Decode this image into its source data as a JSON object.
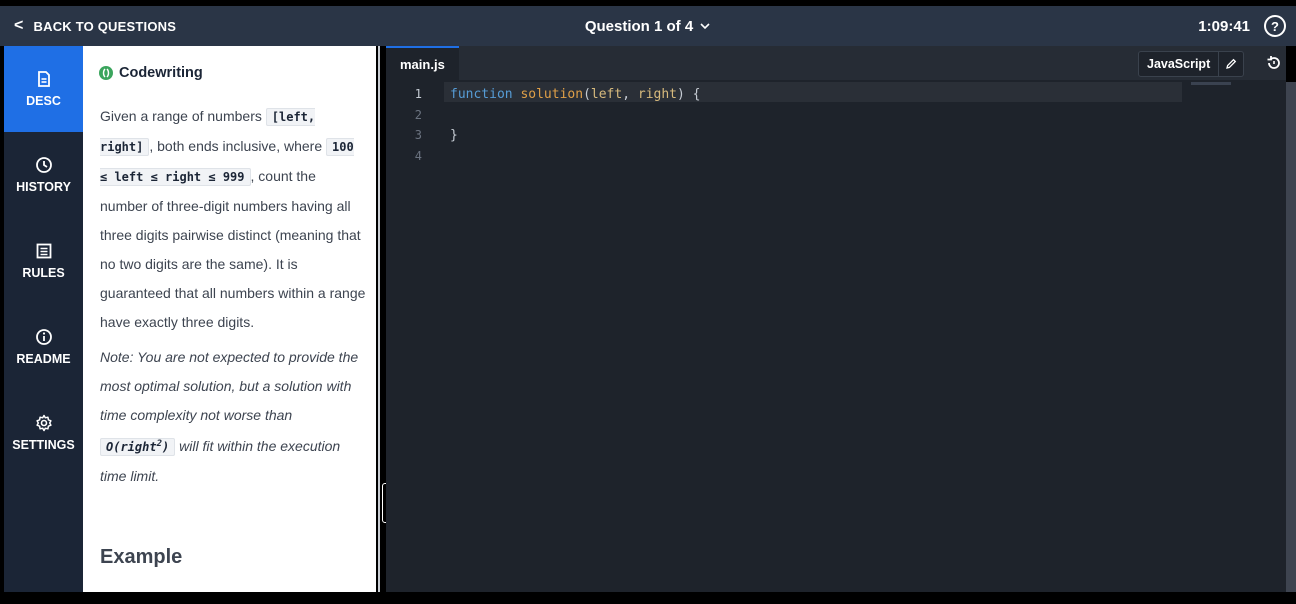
{
  "header": {
    "back_label": "BACK TO QUESTIONS",
    "question_label": "Question 1 of 4",
    "timer": "1:09:41"
  },
  "sidebar": {
    "items": [
      {
        "label": "DESC",
        "icon": "document-icon",
        "active": true
      },
      {
        "label": "HISTORY",
        "icon": "clock-icon",
        "active": false
      },
      {
        "label": "RULES",
        "icon": "list-icon",
        "active": false
      },
      {
        "label": "README",
        "icon": "info-icon",
        "active": false
      },
      {
        "label": "SETTINGS",
        "icon": "gear-icon",
        "active": false
      }
    ]
  },
  "description": {
    "type": "Codewriting",
    "p1": {
      "a": "Given a range of numbers ",
      "code1": "[left, right]",
      "b": ", both ends inclusive, where ",
      "code2": "100 ≤ left ≤ right ≤ 999",
      "c": ", count the number of three-digit numbers having all three digits pairwise distinct (meaning that no two digits are the same). It is guaranteed that all numbers within a range have exactly three digits."
    },
    "note": {
      "a": "Note: You are not expected to provide the most optimal solution, but a solution with time complexity not worse than ",
      "code_base": "O(right",
      "code_exp": "2",
      "code_close": ")",
      "b": " will fit within the execution time limit."
    },
    "example_heading": "Example"
  },
  "editor": {
    "filename": "main.js",
    "language": "JavaScript",
    "colors": {
      "keyword": "#569cd6",
      "function": "#e0a048",
      "param": "#d7ba7d",
      "accent": "#1f6fe5"
    },
    "line_numbers": [
      "1",
      "2",
      "3",
      "4"
    ],
    "code": {
      "kw": "function",
      "fn": "solution",
      "open": "(",
      "p1": "left",
      "comma": ", ",
      "p2": "right",
      "close": ") {",
      "brace": "}"
    }
  }
}
